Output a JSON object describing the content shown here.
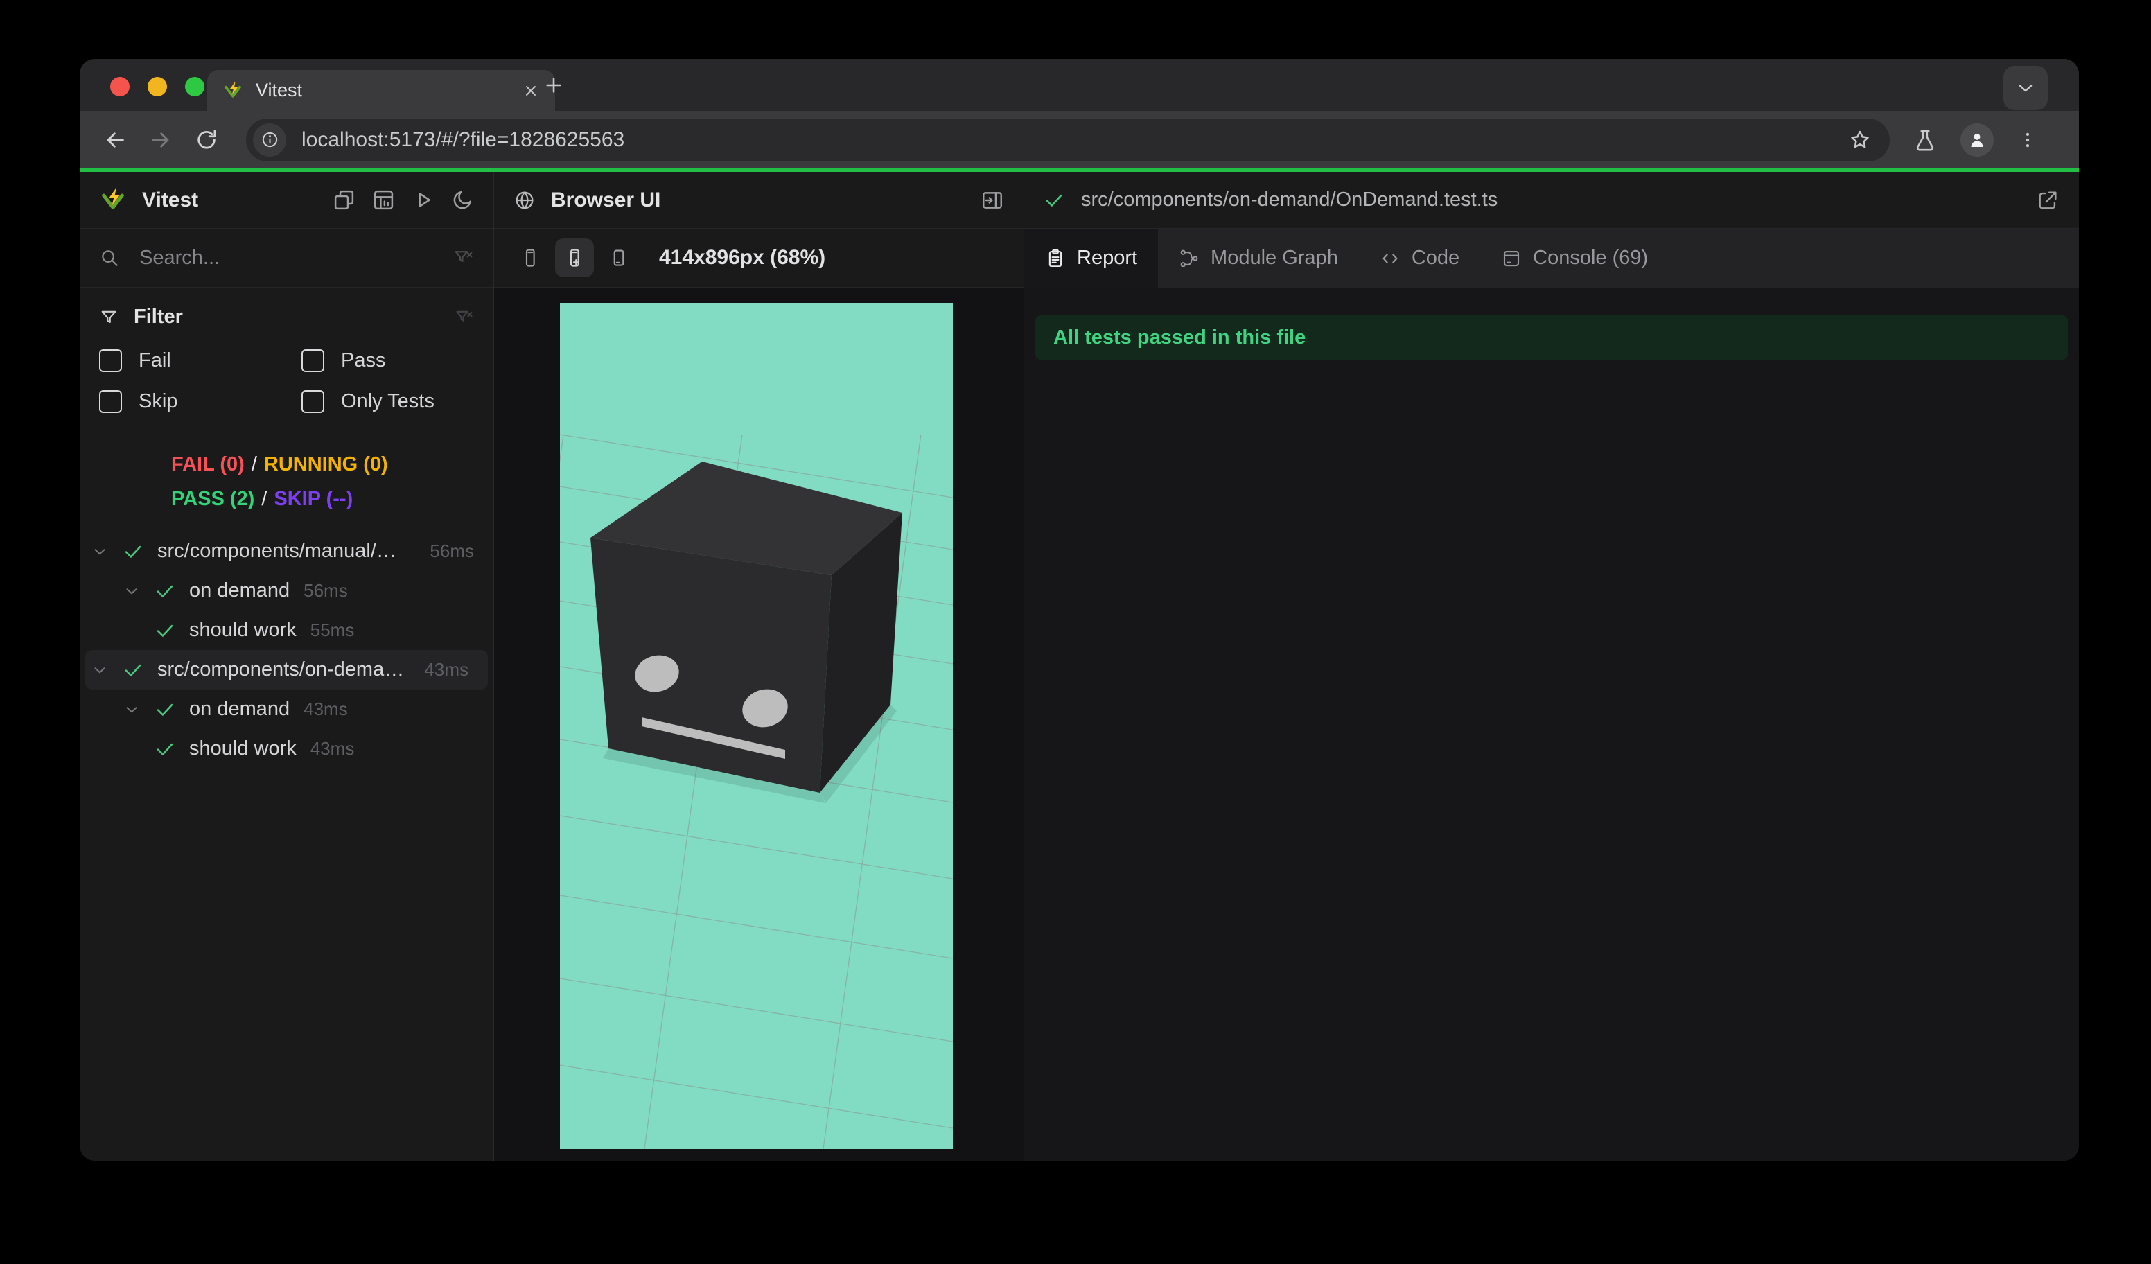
{
  "window": {
    "tab_title": "Vitest",
    "url": "localhost:5173/#/?file=1828625563"
  },
  "sidebar": {
    "title": "Vitest",
    "search_placeholder": "Search...",
    "filter": {
      "title": "Filter",
      "fail": "Fail",
      "pass": "Pass",
      "skip": "Skip",
      "only_tests": "Only Tests"
    },
    "summary": {
      "fail": "FAIL (0)",
      "slash": "/",
      "running": "RUNNING (0)",
      "pass": "PASS (2)",
      "skip": "SKIP (--)"
    },
    "tree": [
      {
        "label": "src/components/manual/…",
        "time": "56ms"
      },
      {
        "label": "on demand",
        "time": "56ms"
      },
      {
        "label": "should work",
        "time": "55ms"
      },
      {
        "label": "src/components/on-dema…",
        "time": "43ms"
      },
      {
        "label": "on demand",
        "time": "43ms"
      },
      {
        "label": "should work",
        "time": "43ms"
      }
    ]
  },
  "preview": {
    "title": "Browser UI",
    "viewport": "414x896px (68%)"
  },
  "report": {
    "file_path": "src/components/on-demand/OnDemand.test.ts",
    "tabs": {
      "report": "Report",
      "module_graph": "Module Graph",
      "code": "Code",
      "console": "Console (69)"
    },
    "banner": "All tests passed in this file"
  },
  "colors": {
    "accent_green": "#21c045",
    "pass_green": "#34d378",
    "fail_red": "#f65157",
    "running_yellow": "#f5b301",
    "skip_purple": "#7e3ff2",
    "check_green": "#4ac97e",
    "banner_bg": "#13291b",
    "banner_text": "#40d482",
    "preview_bg": "#82dcc3",
    "logo_yellow": "#fcc72b",
    "logo_green": "#63a524",
    "traffic_red": "#f4544c",
    "traffic_yellow": "#f0b51f",
    "traffic_green": "#2ec943"
  }
}
